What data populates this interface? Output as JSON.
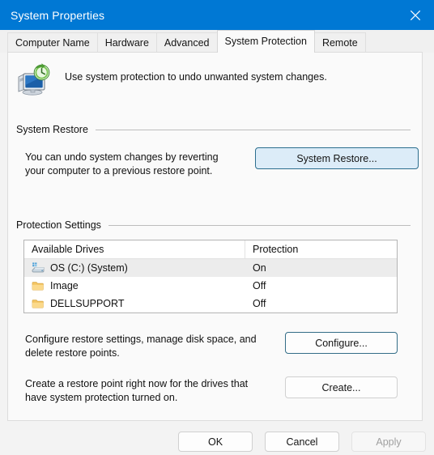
{
  "window": {
    "title": "System Properties",
    "close_icon": "close-icon"
  },
  "tabs": [
    {
      "label": "Computer Name",
      "active": false
    },
    {
      "label": "Hardware",
      "active": false
    },
    {
      "label": "Advanced",
      "active": false
    },
    {
      "label": "System Protection",
      "active": true
    },
    {
      "label": "Remote",
      "active": false
    }
  ],
  "header": {
    "icon": "system-restore-icon",
    "description": "Use system protection to undo unwanted system changes."
  },
  "system_restore": {
    "group_label": "System Restore",
    "description": "You can undo system changes by reverting your computer to a previous restore point.",
    "description_line1": "You can undo system changes by reverting",
    "description_line2": "your computer to a previous restore point.",
    "button_label": "System Restore..."
  },
  "protection_settings": {
    "group_label": "Protection Settings",
    "columns": [
      "Available Drives",
      "Protection"
    ],
    "rows": [
      {
        "drive": "OS (C:) (System)",
        "protection": "On",
        "icon": "hard-drive-icon",
        "selected": true
      },
      {
        "drive": "Image",
        "protection": "Off",
        "icon": "folder-icon",
        "selected": false
      },
      {
        "drive": "DELLSUPPORT",
        "protection": "Off",
        "icon": "folder-icon",
        "selected": false
      }
    ],
    "configure": {
      "description_line1": "Configure restore settings, manage disk space, and",
      "description_line2": "delete restore points.",
      "button_label": "Configure..."
    },
    "create": {
      "description_line1": "Create a restore point right now for the drives that",
      "description_line2": "have system protection turned on.",
      "button_label": "Create..."
    }
  },
  "footer": {
    "ok_label": "OK",
    "cancel_label": "Cancel",
    "apply_label": "Apply",
    "apply_disabled": true
  },
  "colors": {
    "titlebar": "#0078d4",
    "accent_button_fill": "#dcecf8",
    "accent_button_border": "#2c6e8e",
    "panel_background": "#fafafa",
    "dialog_background": "#f3f3f3",
    "folder_icon": "#f5c965",
    "selected_row": "#ececec"
  }
}
